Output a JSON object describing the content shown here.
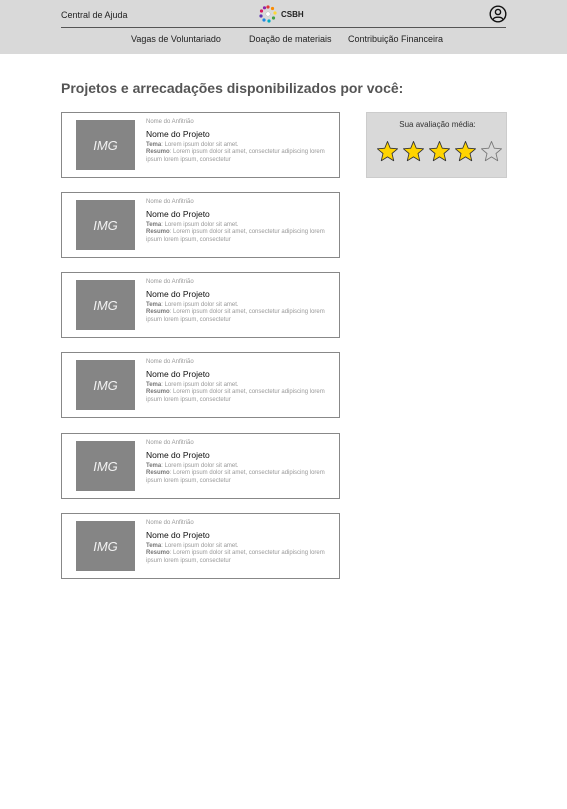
{
  "header": {
    "help_link": "Central de Ajuda",
    "logo_text": "CSBH",
    "nav": [
      "Vagas de Voluntariado",
      "Doação de materiais",
      "Contribuição Financeira"
    ]
  },
  "page_title": "Projetos e arrecadações disponibilizados por você:",
  "cards": [
    {
      "img_label": "IMG",
      "host": "Nome do Anfitrião",
      "name": "Nome do Projeto",
      "tema_label": "Tema",
      "tema": ": Lorem ipsum dolor sit amet.",
      "resumo_label": "Resumo",
      "resumo": ": Lorem ipsum dolor sit amet, consectetur adipiscing lorem ipsum lorem ipsum, consectetur"
    },
    {
      "img_label": "IMG",
      "host": "Nome do Anfitrião",
      "name": "Nome do Projeto",
      "tema_label": "Tema",
      "tema": ": Lorem ipsum dolor sit amet.",
      "resumo_label": "Resumo",
      "resumo": ": Lorem ipsum dolor sit amet, consectetur adipiscing lorem ipsum lorem ipsum, consectetur"
    },
    {
      "img_label": "IMG",
      "host": "Nome do Anfitrião",
      "name": "Nome do Projeto",
      "tema_label": "Tema",
      "tema": ": Lorem ipsum dolor sit amet.",
      "resumo_label": "Resumo",
      "resumo": ": Lorem ipsum dolor sit amet, consectetur adipiscing lorem ipsum lorem ipsum, consectetur"
    },
    {
      "img_label": "IMG",
      "host": "Nome do Anfitrião",
      "name": "Nome do Projeto",
      "tema_label": "Tema",
      "tema": ": Lorem ipsum dolor sit amet.",
      "resumo_label": "Resumo",
      "resumo": ": Lorem ipsum dolor sit amet, consectetur adipiscing lorem ipsum lorem ipsum, consectetur"
    },
    {
      "img_label": "IMG",
      "host": "Nome do Anfitrião",
      "name": "Nome do Projeto",
      "tema_label": "Tema",
      "tema": ": Lorem ipsum dolor sit amet.",
      "resumo_label": "Resumo",
      "resumo": ": Lorem ipsum dolor sit amet, consectetur adipiscing lorem ipsum lorem ipsum, consectetur"
    },
    {
      "img_label": "IMG",
      "host": "Nome do Anfitrião",
      "name": "Nome do Projeto",
      "tema_label": "Tema",
      "tema": ": Lorem ipsum dolor sit amet.",
      "resumo_label": "Resumo",
      "resumo": ": Lorem ipsum dolor sit amet, consectetur adipiscing lorem ipsum lorem ipsum, consectetur"
    }
  ],
  "rating": {
    "title": "Sua avaliação média:",
    "value": 4,
    "max": 5,
    "star_color": "#ffd400"
  },
  "colors": {
    "header_bg": "#d9d9d9",
    "image_placeholder": "#858585",
    "rating_bg": "#d9d9d9"
  }
}
